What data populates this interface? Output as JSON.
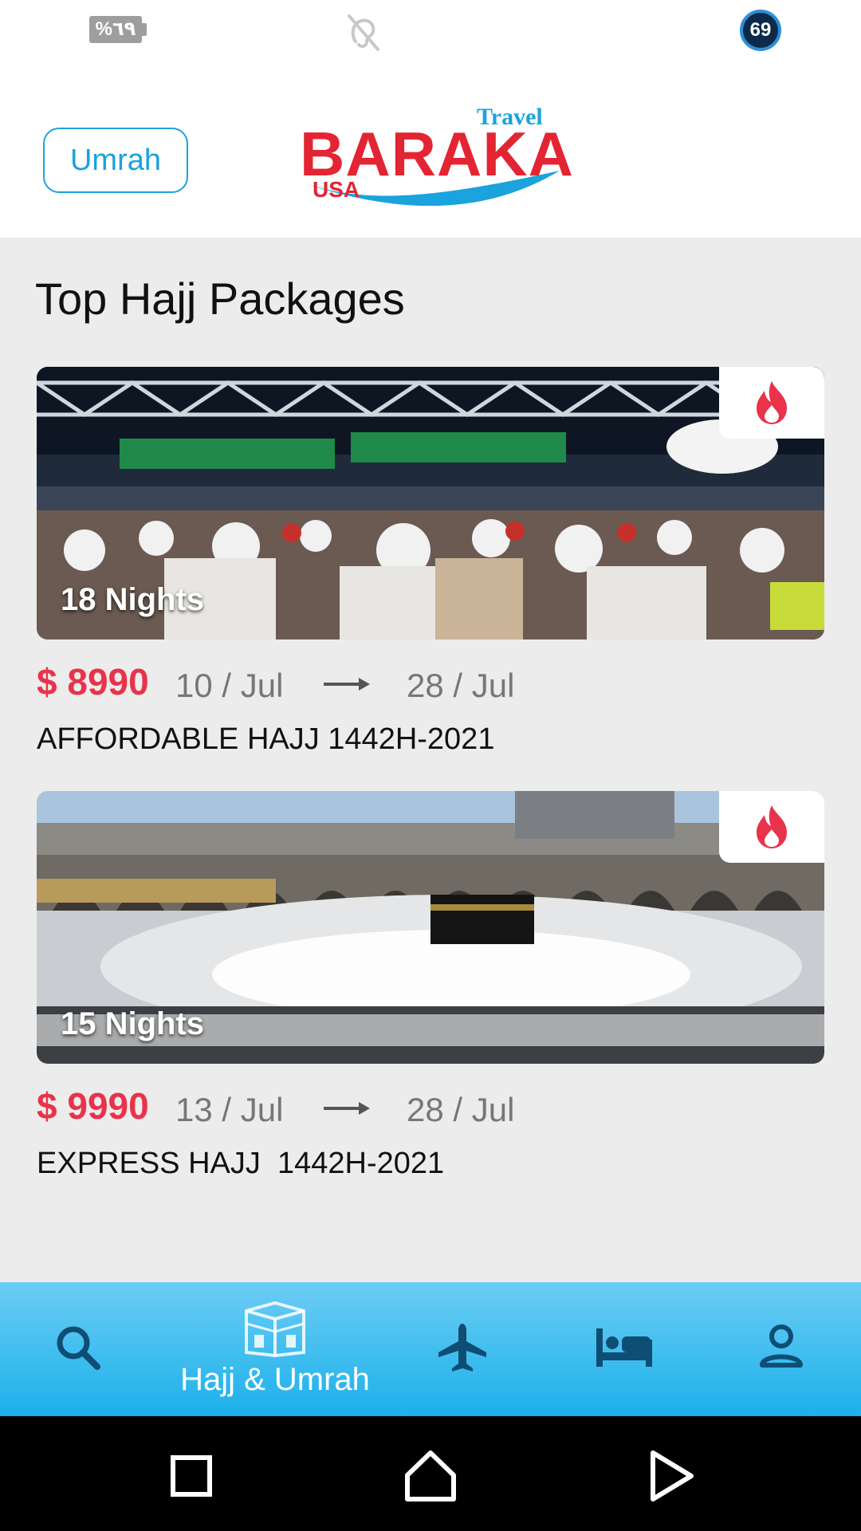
{
  "status_bar": {
    "battery_text": "%٦٩",
    "hearing_icon": "hearing-disabled-icon",
    "notification_count": "69"
  },
  "header": {
    "umrah_button": "Umrah",
    "logo": {
      "travel": "Travel",
      "name": "BARAKA",
      "country": "USA"
    }
  },
  "section": {
    "title": "Top Hajj Packages"
  },
  "packages": [
    {
      "nights": "18 Nights",
      "price": "$ 8990",
      "date_from": "10 / Jul",
      "date_to": "28 / Jul",
      "name": "AFFORDABLE HAJJ 1442H-2021",
      "badge_icon": "fire-icon"
    },
    {
      "nights": "15 Nights",
      "price": "$ 9990",
      "date_from": "13 / Jul",
      "date_to": "28 / Jul",
      "name": "EXPRESS HAJJ  1442H-2021",
      "badge_icon": "fire-icon"
    }
  ],
  "bottom_nav": {
    "active_label": "Hajj & Umrah",
    "items": [
      "search-icon",
      "kaaba-icon",
      "flight-icon",
      "hotel-icon",
      "profile-icon"
    ]
  },
  "colors": {
    "accent_blue": "#1aa3dc",
    "price_red": "#e8334a",
    "nav_gradient_top": "#6ccdf5",
    "nav_gradient_bottom": "#1cb0ea"
  }
}
